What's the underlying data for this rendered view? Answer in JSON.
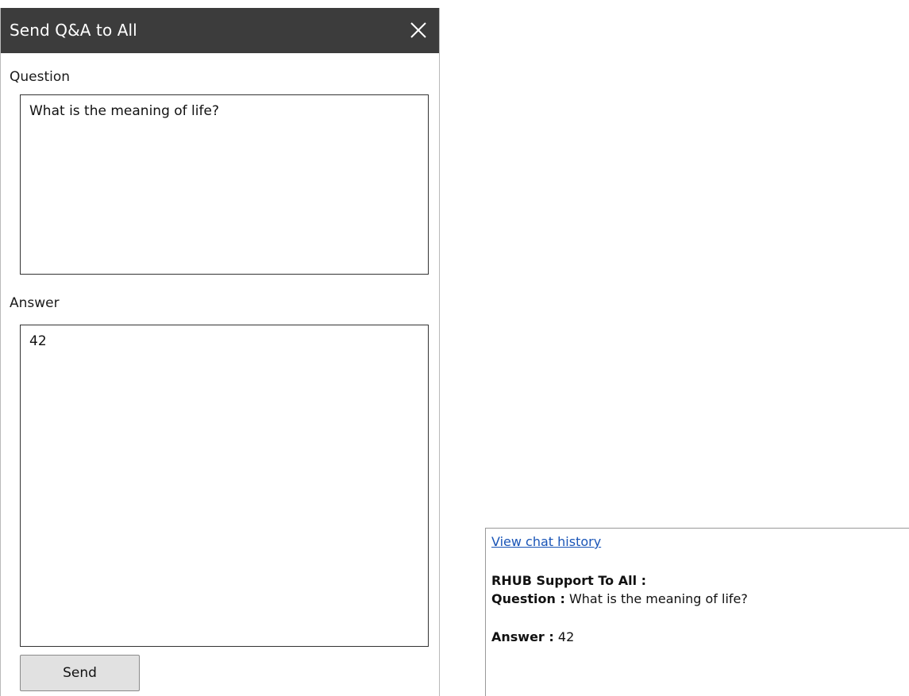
{
  "dialog": {
    "title": "Send Q&A to All",
    "question_label": "Question",
    "question_value": "What is the meaning of life?",
    "answer_label": "Answer",
    "answer_value": "42",
    "send_label": "Send",
    "close_icon": "close-icon"
  },
  "chat": {
    "history_link": "View chat history",
    "sender": "RHUB Support To All :",
    "question_key": "Question :",
    "question_text": " What is the meaning of life?",
    "answer_key": "Answer :",
    "answer_text": " 42"
  },
  "colors": {
    "titlebar": "#3c3c3c",
    "link": "#1a55b7",
    "button": "#e1e1e1"
  }
}
